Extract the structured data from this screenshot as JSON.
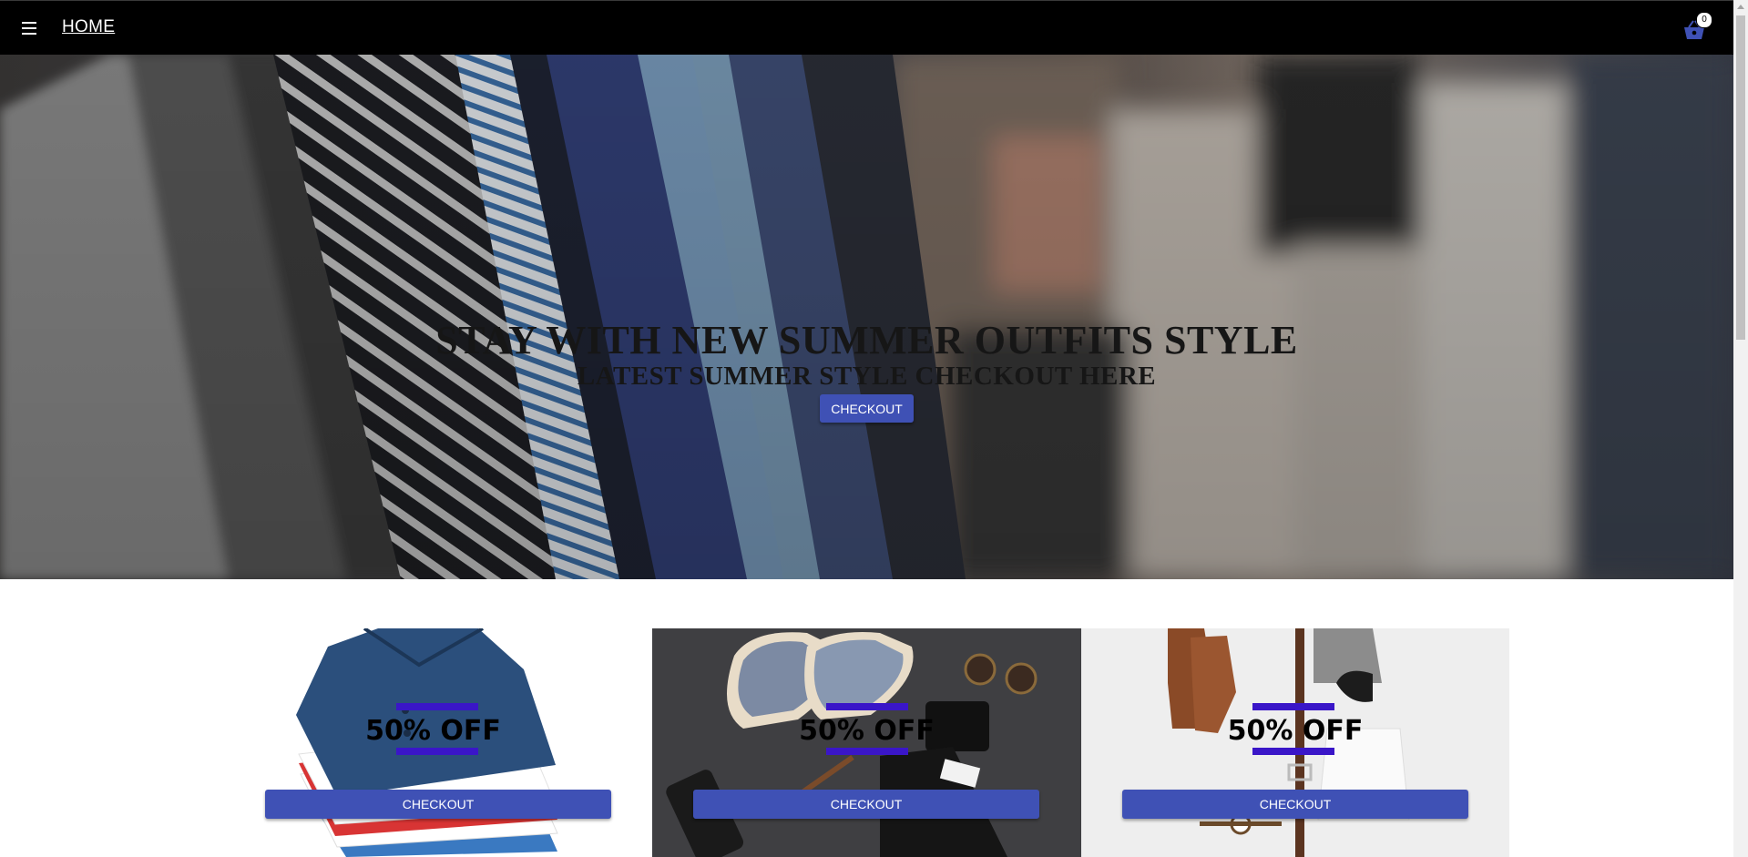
{
  "navbar": {
    "menu_icon": "menu-icon",
    "home_label": "HOME",
    "cart_icon": "shopping-basket-icon",
    "cart_count": "0"
  },
  "hero": {
    "title": "STAY WITH NEW SUMMER OUTFITS STYLE",
    "subtitle": "LATEST SUMMER STYLE CHECKOUT HERE",
    "button_label": "CHECKOUT"
  },
  "offers": [
    {
      "text": "50% OFF",
      "button_label": "CHECKOUT"
    },
    {
      "text": "50% OFF",
      "button_label": "CHECKOUT"
    },
    {
      "text": "50% OFF",
      "button_label": "CHECKOUT"
    }
  ],
  "colors": {
    "navbar_bg": "#000000",
    "button_bg": "#3f51b5",
    "offer_accent": "#3a16c8"
  }
}
